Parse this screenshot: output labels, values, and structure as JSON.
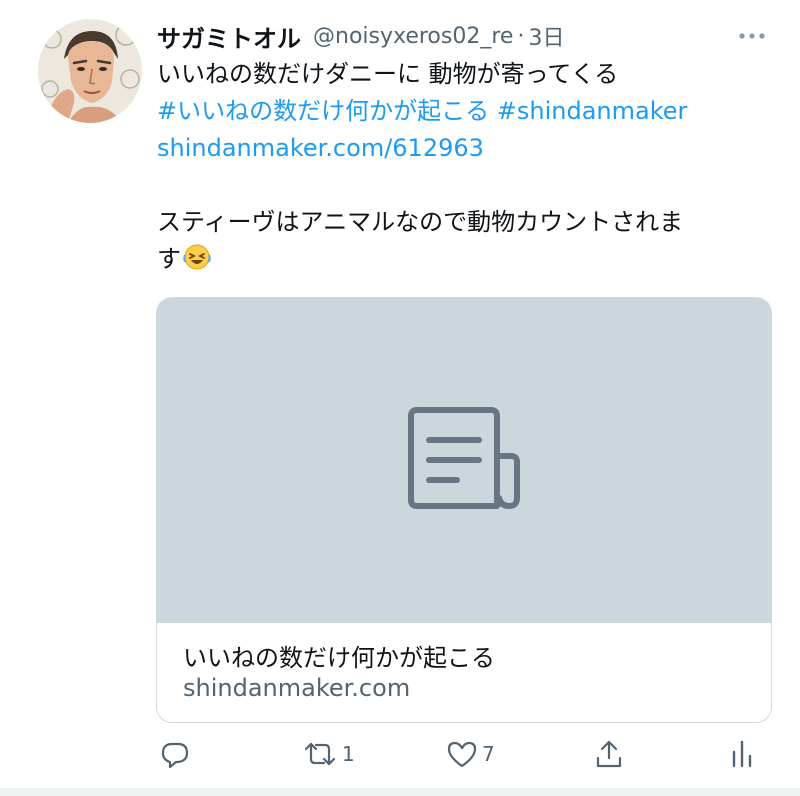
{
  "tweet": {
    "display_name": "サガミトオル",
    "handle": "@noisyxeros02_re",
    "separator": "·",
    "time": "3日",
    "text_lines": [
      "いいねの数だけダニーに 動物が寄ってくる"
    ],
    "hashtag_1": "#いいねの数だけ何かが起こる",
    "hashtag_2": "#shindanmaker",
    "link": "shindanmaker.com/612963",
    "body_line_1": "スティーヴはアニマルなので動物カウントされま",
    "body_line_2": "す",
    "emoji": "🤣"
  },
  "card": {
    "title": "いいねの数だけ何かが起こる",
    "domain": "shindanmaker.com",
    "icon": "article-icon"
  },
  "actions": {
    "reply_count": "",
    "retweet_count": "1",
    "like_count": "7"
  },
  "icons": {
    "more": "more-dots-icon",
    "reply": "reply-icon",
    "retweet": "retweet-icon",
    "like": "heart-icon",
    "share": "share-icon",
    "analytics": "analytics-icon"
  },
  "colors": {
    "link": "#1d9bf0",
    "secondary": "#536471",
    "card_media_bg": "#ccd6dd",
    "icon_gray": "#687684"
  }
}
